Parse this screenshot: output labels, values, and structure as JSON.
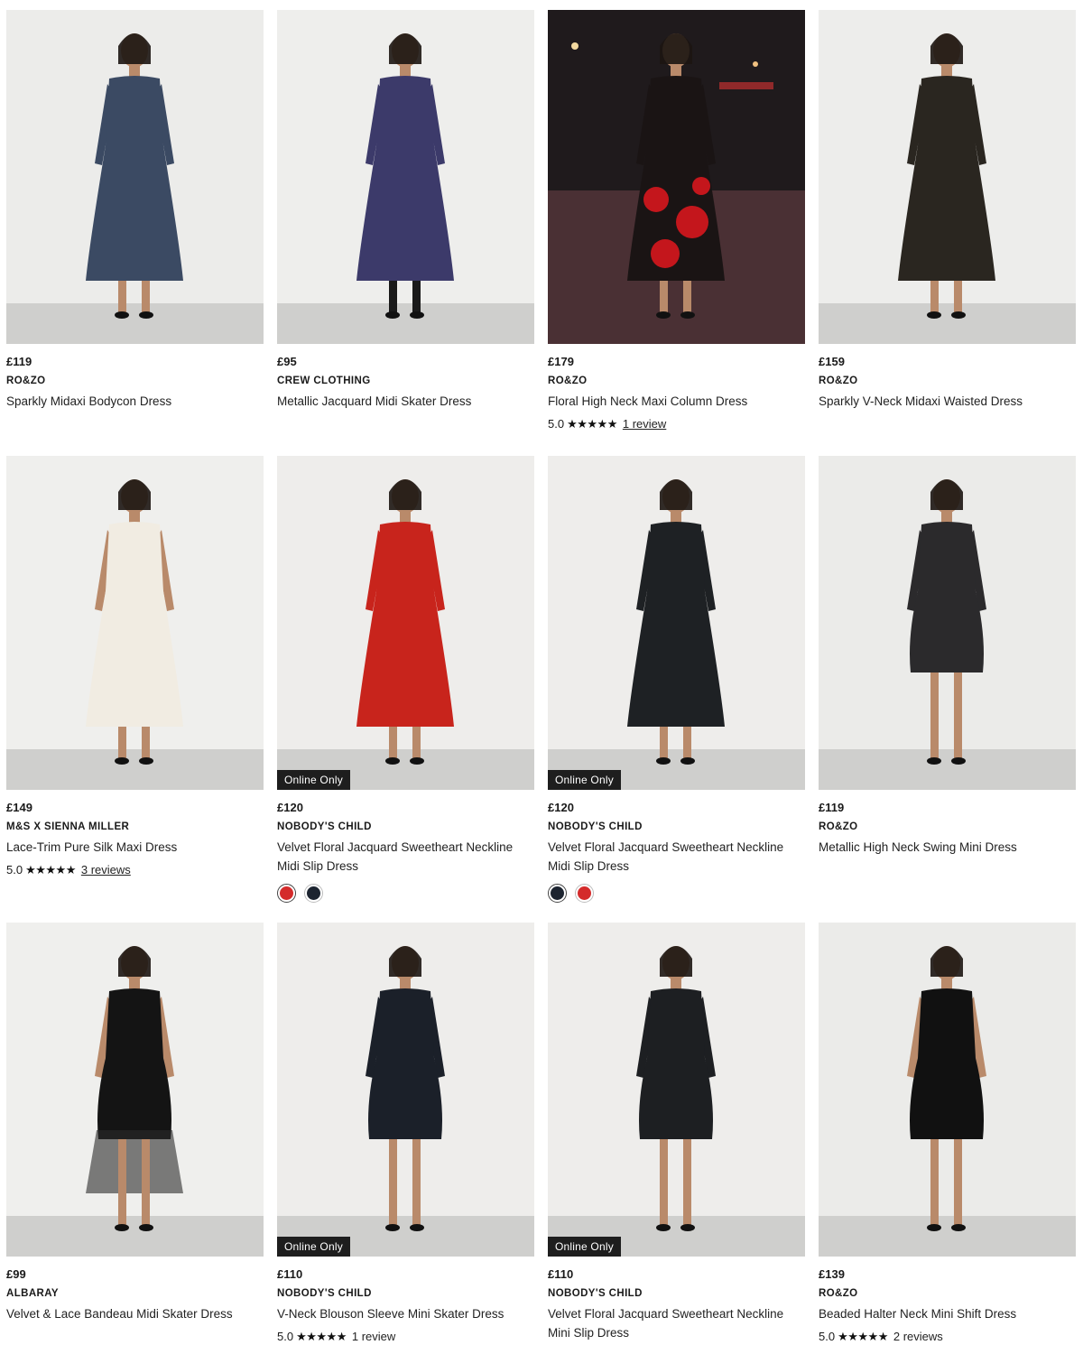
{
  "products": [
    {
      "price": "£119",
      "brand": "RO&ZO",
      "name": "Sparkly Midaxi Bodycon Dress",
      "image_icon": "model-in-blue-sparkly-dress",
      "bg": "#ececea",
      "dress": "#3b4a63"
    },
    {
      "price": "£95",
      "brand": "CREW CLOTHING",
      "name": "Metallic Jacquard Midi Skater Dress",
      "image_icon": "model-in-purple-jacquard-dress",
      "bg": "#eeeeec",
      "dress": "#3c3a6a"
    },
    {
      "price": "£179",
      "brand": "RO&ZO",
      "name": "Floral High Neck Maxi Column Dress",
      "rating": "5.0",
      "stars": "★★★★★",
      "reviews": "1 review",
      "image_icon": "model-in-black-red-floral-dress",
      "bg": "#1f1a1c",
      "dress": "#1a1414"
    },
    {
      "price": "£159",
      "brand": "RO&ZO",
      "name": "Sparkly V-Neck Midaxi Waisted Dress",
      "image_icon": "model-in-black-gold-dress",
      "bg": "#ededeb",
      "dress": "#2a2620"
    },
    {
      "price": "£149",
      "brand": "M&S X SIENNA MILLER",
      "name": "Lace-Trim Pure Silk Maxi Dress",
      "rating": "5.0",
      "stars": "★★★★★",
      "reviews": "3 reviews",
      "image_icon": "model-in-ivory-silk-dress",
      "bg": "#efefed",
      "dress": "#f1ece2"
    },
    {
      "price": "£120",
      "brand": "NOBODY'S CHILD",
      "name": "Velvet Floral Jacquard Sweetheart Neckline Midi Slip Dress",
      "badge": "Online Only",
      "swatches": [
        "#d42b2b",
        "#1c2430"
      ],
      "image_icon": "model-in-red-slip-dress",
      "bg": "#eeedeb",
      "dress": "#c8241c"
    },
    {
      "price": "£120",
      "brand": "NOBODY'S CHILD",
      "name": "Velvet Floral Jacquard Sweetheart Neckline Midi Slip Dress",
      "badge": "Online Only",
      "swatches": [
        "#1c2430",
        "#d42b2b"
      ],
      "image_icon": "model-in-black-slip-dress",
      "bg": "#eeedeb",
      "dress": "#1e2124"
    },
    {
      "price": "£119",
      "brand": "RO&ZO",
      "name": "Metallic High Neck Swing Mini Dress",
      "image_icon": "model-in-black-metallic-mini-dress",
      "bg": "#ebebe9",
      "dress": "#2b2a2c"
    },
    {
      "price": "£99",
      "brand": "ALBARAY",
      "name": "Velvet & Lace Bandeau Midi Skater Dress",
      "image_icon": "model-in-black-bandeau-dress",
      "bg": "#efefed",
      "dress": "#141414"
    },
    {
      "price": "£110",
      "brand": "NOBODY'S CHILD",
      "name": "V-Neck Blouson Sleeve Mini Skater Dress",
      "badge": "Online Only",
      "rating": "5.0",
      "stars": "★★★★★",
      "reviews": "1 review",
      "image_icon": "model-in-navy-mini-dress",
      "bg": "#eeedeb",
      "dress": "#1b2029"
    },
    {
      "price": "£110",
      "brand": "NOBODY'S CHILD",
      "name": "Velvet Floral Jacquard Sweetheart Neckline Mini Slip Dress",
      "badge": "Online Only",
      "image_icon": "model-in-black-mini-slip-dress",
      "bg": "#eeedeb",
      "dress": "#1d1f22"
    },
    {
      "price": "£139",
      "brand": "RO&ZO",
      "name": "Beaded Halter Neck Mini Shift Dress",
      "rating": "5.0",
      "stars": "★★★★★",
      "reviews": "2 reviews",
      "image_icon": "model-in-black-shift-dress",
      "bg": "#ebebe9",
      "dress": "#111111"
    }
  ]
}
